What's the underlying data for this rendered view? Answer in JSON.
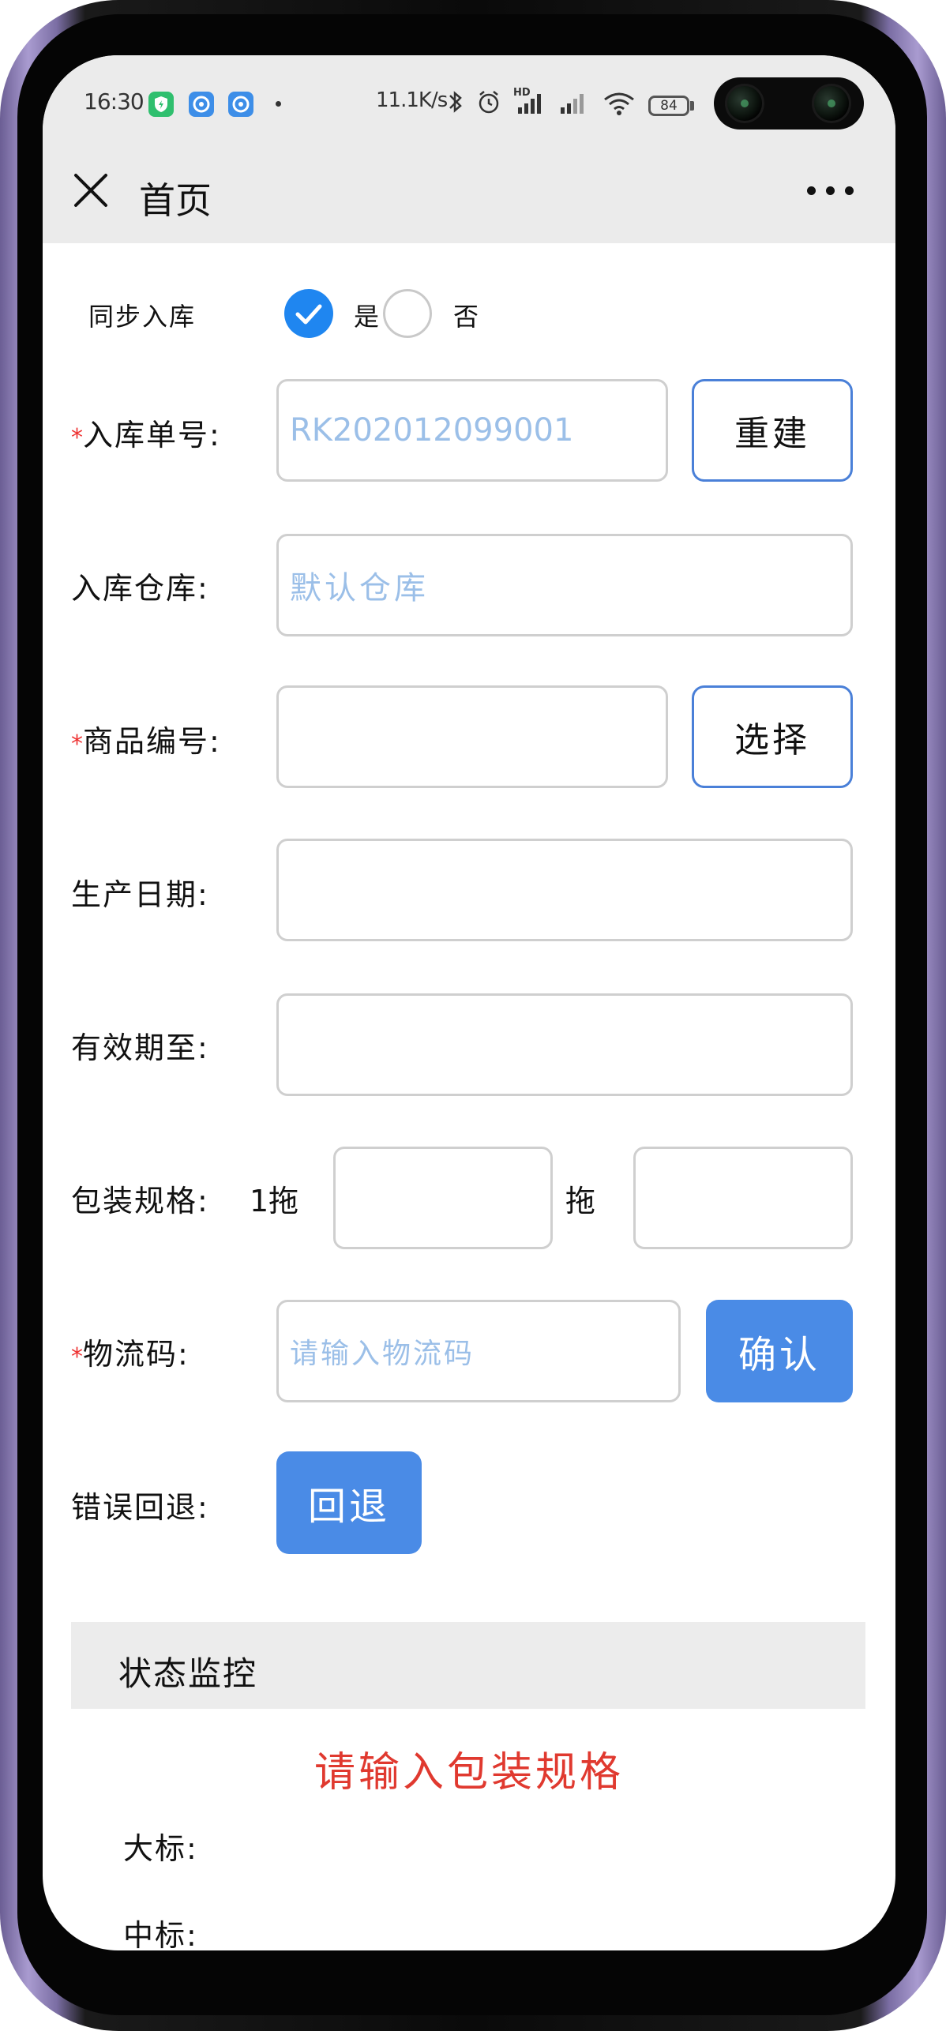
{
  "status_bar": {
    "time": "16:30",
    "net_speed": "11.1K/s",
    "battery": "84",
    "hd_label": "HD"
  },
  "nav": {
    "title": "首页"
  },
  "form": {
    "sync_label": "同步入库",
    "sync_yes": "是",
    "sync_no": "否",
    "order_no_label": "入库单号:",
    "order_no_value": "RK202012099001",
    "rebuild_button": "重建",
    "warehouse_label": "入库仓库:",
    "warehouse_placeholder": "默认仓库",
    "product_code_label": "商品编号:",
    "select_button": "选择",
    "production_date_label": "生产日期:",
    "expiry_label": "有效期至:",
    "packing_label": "包装规格:",
    "packing_prefix": "1拖",
    "packing_mid": "拖",
    "logistics_label": "物流码:",
    "logistics_placeholder": "请输入物流码",
    "confirm_button": "确认",
    "rollback_label": "错误回退:",
    "rollback_button": "回退",
    "required_mark": "*"
  },
  "monitor": {
    "title": "状态监控",
    "message": "请输入包装规格",
    "big_label": "大标:",
    "mid_label": "中标:"
  },
  "colors": {
    "accent": "#4a8be6",
    "check": "#1f86f0",
    "error": "#e0392f",
    "placeholder": "#9bbfe8"
  }
}
